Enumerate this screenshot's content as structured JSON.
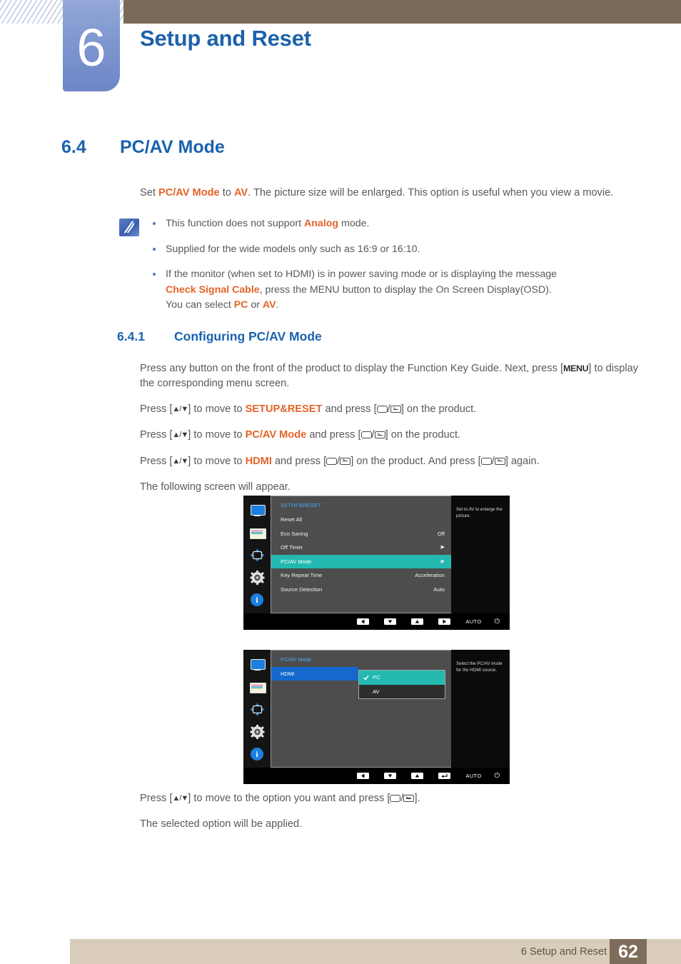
{
  "header": {
    "chapter_number": "6",
    "chapter_title": "Setup and Reset"
  },
  "section": {
    "number": "6.4",
    "title": "PC/AV Mode",
    "intro_pre": "Set ",
    "intro_b1": "PC/AV Mode",
    "intro_mid": " to ",
    "intro_b2": "AV",
    "intro_post": ". The picture size will be enlarged. This option is useful when you view a movie."
  },
  "note": {
    "icon": "note-pencil-icon",
    "items": [
      {
        "pre": "This function does not support ",
        "b1": "Analog",
        "post": " mode."
      },
      {
        "pre": "Supplied for the wide models only such as 16:9 or 16:10.",
        "b1": "",
        "post": ""
      },
      {
        "line1": "If the monitor (when set to HDMI) is in power saving mode or is displaying the message",
        "b1": "Check Signal Cable",
        "line2_post": ", press the MENU button to display the On Screen Display(OSD).",
        "line3_pre": "You can select ",
        "b2": "PC",
        "line3_mid": " or ",
        "b3": "AV",
        "line3_post": "."
      }
    ]
  },
  "subsection": {
    "number": "6.4.1",
    "title": "Configuring PC/AV Mode",
    "step_intro_a": "Press any button on the front of the product to display the Function Key Guide. Next, press [",
    "step_intro_key": "MENU",
    "step_intro_b": "] to display the corresponding menu screen.",
    "step1_a": "Press [",
    "step1_b": "] to move to ",
    "step1_target": "SETUP&RESET",
    "step1_c": " and press [",
    "step1_d": "] on the product.",
    "step2_target": "PC/AV Mode",
    "step3_target": "HDMI",
    "step3_tail": "] on the product. And press [",
    "step3_tail2": "] again.",
    "step4": "The following screen will appear.",
    "after1_a": "Press [",
    "after1_b": "] to move to the option you want and press [",
    "after1_c": "].",
    "after2": "The selected option will be applied."
  },
  "osd1": {
    "title": "SETUP&RESET",
    "sidebar_icons": [
      "monitor-icon",
      "picture-icon",
      "position-icon",
      "gear-icon",
      "info-icon"
    ],
    "rows": [
      {
        "label": "Reset All",
        "value": "",
        "arrow": false,
        "selected": false
      },
      {
        "label": "Eco Saving",
        "value": "Off",
        "arrow": false,
        "selected": false
      },
      {
        "label": "Off Timer",
        "value": "",
        "arrow": true,
        "selected": false
      },
      {
        "label": "PC/AV Mode",
        "value": "",
        "arrow": true,
        "selected": true
      },
      {
        "label": "Key Repeat Time",
        "value": "Acceleration",
        "arrow": false,
        "selected": false
      },
      {
        "label": "Source Detection",
        "value": "Auto",
        "arrow": false,
        "selected": false
      }
    ],
    "help": "Set to AV to enlarge the picture.",
    "bar": {
      "keys": [
        "left-arrow-icon",
        "down-arrow-icon",
        "up-arrow-icon",
        "right-arrow-icon"
      ],
      "auto_label": "AUTO",
      "power_icon": "power-icon"
    }
  },
  "osd2": {
    "title": "PC/AV Mode",
    "source_label": "HDMI",
    "options": [
      {
        "label": "PC",
        "checked": true
      },
      {
        "label": "AV",
        "checked": false
      }
    ],
    "help": "Select the PC/AV mode for the HDMI source.",
    "bar": {
      "keys": [
        "left-arrow-icon",
        "down-arrow-icon",
        "up-arrow-icon",
        "enter-icon"
      ],
      "auto_label": "AUTO",
      "power_icon": "power-icon"
    }
  },
  "footer": {
    "text": "6 Setup and Reset",
    "page": "62"
  },
  "colors": {
    "heading_blue": "#1a62ae",
    "accent_orange": "#e4632a",
    "header_brown": "#796b57",
    "footer_tan": "#d9cdba",
    "osd_highlight": "#23b9b0"
  }
}
